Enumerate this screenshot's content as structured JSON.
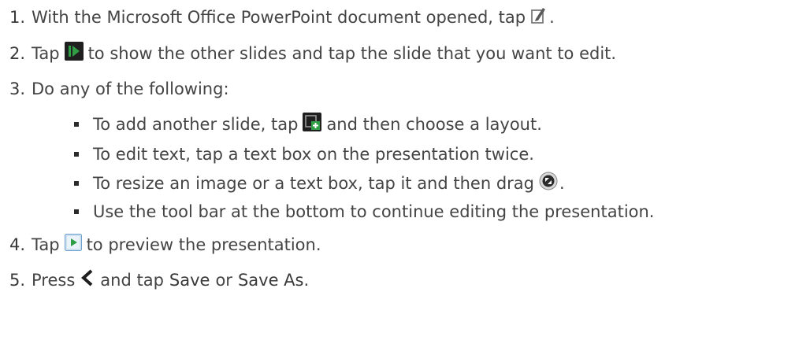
{
  "steps": [
    {
      "number": "1.",
      "text_before": "With the Microsoft Office PowerPoint document opened, tap",
      "icon": "edit-pencil-icon",
      "text_after": "."
    },
    {
      "number": "2.",
      "text_before": "Tap",
      "icon": "show-slides-icon",
      "text_after": "to show the other slides and tap the slide that you want to edit."
    },
    {
      "number": "3.",
      "text": "Do any of the following:",
      "bullets": [
        {
          "text_before": "To add another slide, tap",
          "icon": "add-slide-icon",
          "text_after": "and then choose a layout."
        },
        {
          "text": "To edit text, tap a text box on the presentation twice."
        },
        {
          "text_before": "To resize an image or a text box, tap it and then drag",
          "icon": "resize-handle-icon",
          "text_after": "."
        },
        {
          "text": "Use the tool bar at the bottom to continue editing the presentation."
        }
      ]
    },
    {
      "number": "4.",
      "text_before": "Tap",
      "icon": "preview-play-icon",
      "text_after": "to preview the presentation."
    },
    {
      "number": "5.",
      "text_before": "Press",
      "icon": "back-arrow-icon",
      "text_middle": "and tap",
      "save_label": "Save",
      "or_label": "or",
      "save_as_label": "Save As",
      "text_after": "."
    }
  ],
  "colors": {
    "text": "#444444",
    "icon_dark": "#1f1f1f",
    "icon_green": "#2f9e45",
    "icon_blue": "#6a9fd0"
  }
}
